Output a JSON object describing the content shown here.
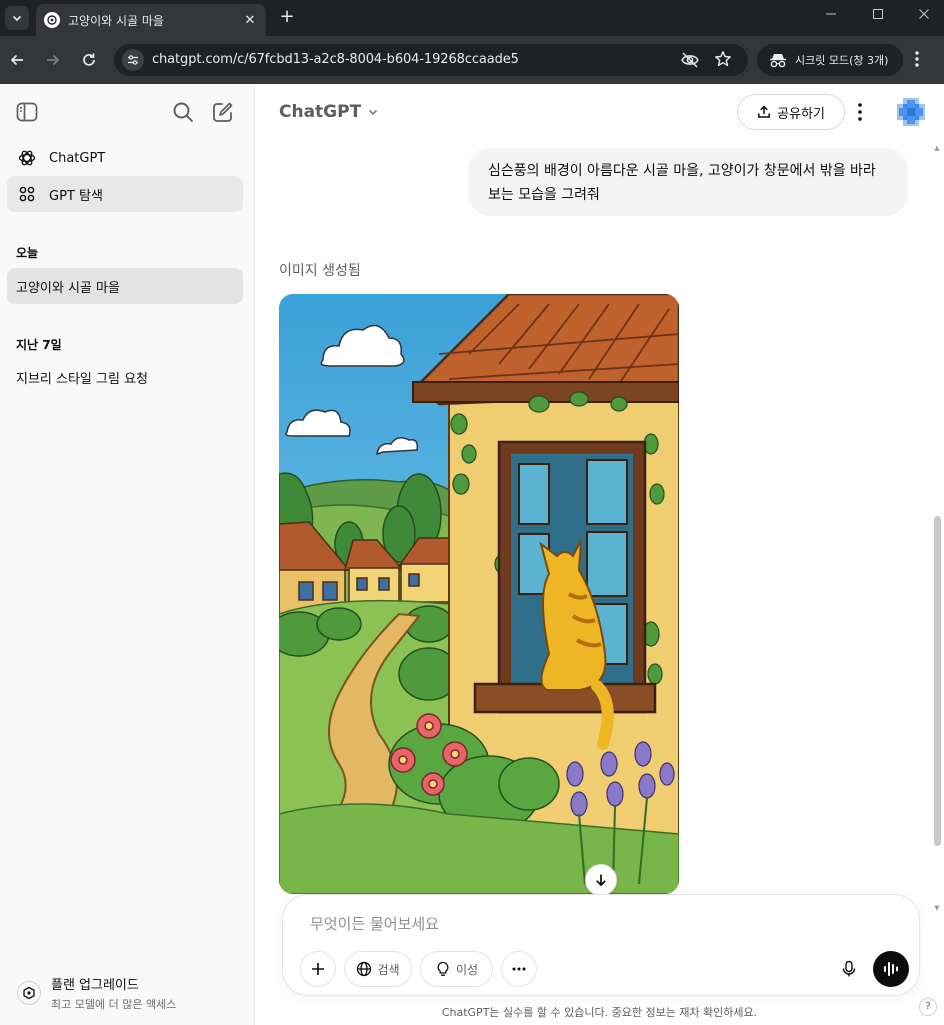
{
  "browser": {
    "tab_title": "고양이와 시골 마을",
    "new_tab_label": "+",
    "url": "chatgpt.com/c/67fcbd13-a2c8-8004-b604-19268ccaade5",
    "incognito_label": "시크릿 모드(창 3개)"
  },
  "sidebar": {
    "nav": [
      {
        "label": "ChatGPT",
        "icon": "openai-logo-icon"
      },
      {
        "label": "GPT 탐색",
        "icon": "grid-icon"
      }
    ],
    "sections": [
      {
        "title": "오늘",
        "items": [
          "고양이와 시골 마을"
        ]
      },
      {
        "title": "지난 7일",
        "items": [
          "지브리 스타일 그림 요청"
        ]
      }
    ],
    "upgrade": {
      "title": "플랜 업그레이드",
      "subtitle": "최고 모델에 더 많은 액세스"
    }
  },
  "header": {
    "model": "ChatGPT",
    "share_label": "공유하기"
  },
  "conversation": {
    "user_message": "심슨풍의 배경이 아름다운 시골 마을, 고양이가 창문에서 밖을 바라보는 모습을 그려줘",
    "image_status": "이미지 생성됨"
  },
  "composer": {
    "placeholder": "무엇이든 물어보세요",
    "search_label": "검색",
    "reason_label": "이성"
  },
  "footer": {
    "disclaimer": "ChatGPT는 실수를 할 수 있습니다. 중요한 정보는 재차 확인하세요.",
    "help": "?"
  },
  "colors": {
    "sidebar_bg": "#f9f9f9",
    "browser_dark": "#202124",
    "user_bubble": "#f4f4f4",
    "accent_black": "#0d0d0d"
  }
}
